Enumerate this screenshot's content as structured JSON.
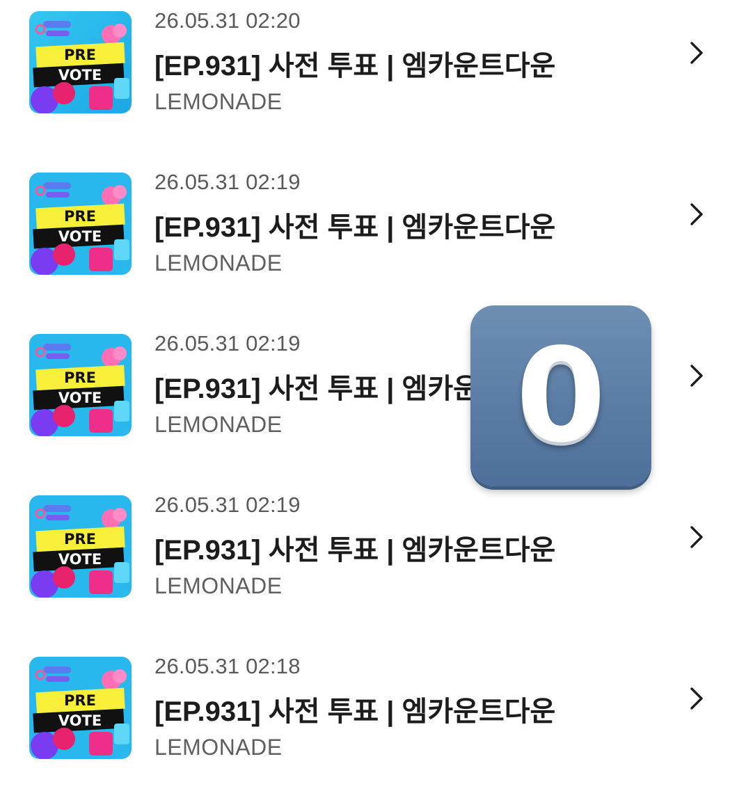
{
  "items": [
    {
      "date": "26.05.31 02:20",
      "title": "[EP.931] 사전 투표 | 엠카운트다운",
      "subtitle": "LEMONADE",
      "thumb_line1": "PRE",
      "thumb_line2": "VOTE"
    },
    {
      "date": "26.05.31 02:19",
      "title": "[EP.931] 사전 투표 | 엠카운트다운",
      "subtitle": "LEMONADE",
      "thumb_line1": "PRE",
      "thumb_line2": "VOTE"
    },
    {
      "date": "26.05.31 02:19",
      "title": "[EP.931] 사전 투표 | 엠카운트다운",
      "subtitle": "LEMONADE",
      "thumb_line1": "PRE",
      "thumb_line2": "VOTE"
    },
    {
      "date": "26.05.31 02:19",
      "title": "[EP.931] 사전 투표 | 엠카운트다운",
      "subtitle": "LEMONADE",
      "thumb_line1": "PRE",
      "thumb_line2": "VOTE"
    },
    {
      "date": "26.05.31 02:18",
      "title": "[EP.931] 사전 투표 | 엠카운트다운",
      "subtitle": "LEMONADE",
      "thumb_line1": "PRE",
      "thumb_line2": "VOTE"
    }
  ],
  "overlay": {
    "digit": "0",
    "color": "#5b7da5"
  },
  "icons": {
    "row_action": "chevron-right-icon",
    "thumbnail": "pre-vote-thumbnail"
  }
}
